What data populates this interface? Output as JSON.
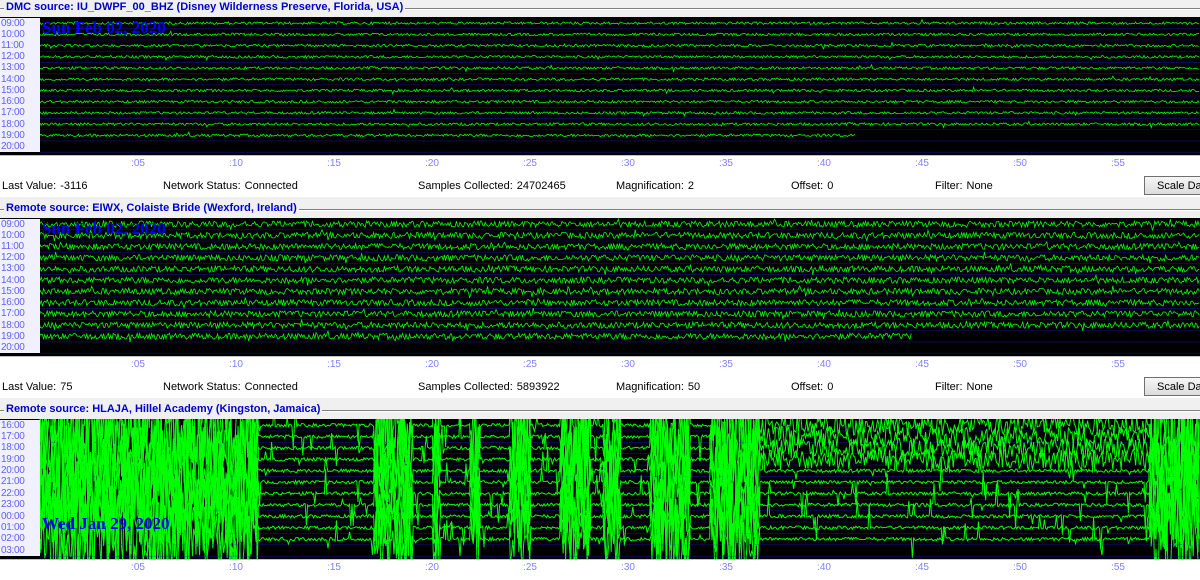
{
  "panels": [
    {
      "source": "DMC source: IU_DWPF_00_BHZ (Disney Wilderness Preserve, Florida, USA)",
      "date": "Sun Feb 02, 2020",
      "hours": [
        "09:00",
        "10:00",
        "11:00",
        "12:00",
        "13:00",
        "14:00",
        "15:00",
        "16:00",
        "17:00",
        "18:00",
        "19:00",
        "20:00"
      ],
      "status": {
        "last_value_label": "Last Value:",
        "last_value": "-3116",
        "network_label": "Network Status:",
        "network": "Connected",
        "samples_label": "Samples Collected:",
        "samples": "24702465",
        "mag_label": "Magnification:",
        "mag": "2",
        "offset_label": "Offset:",
        "offset": "0",
        "filter_label": "Filter:",
        "filter": "None",
        "scale_button": "Scale Data"
      }
    },
    {
      "source": "Remote source: EIWX, Colaiste Bride (Wexford, Ireland)",
      "date": "Sun Feb 02, 2020",
      "hours": [
        "09:00",
        "10:00",
        "11:00",
        "12:00",
        "13:00",
        "14:00",
        "15:00",
        "16:00",
        "17:00",
        "18:00",
        "19:00",
        "20:00"
      ],
      "status": {
        "last_value_label": "Last Value:",
        "last_value": "75",
        "network_label": "Network Status:",
        "network": "Connected",
        "samples_label": "Samples Collected:",
        "samples": "5893922",
        "mag_label": "Magnification:",
        "mag": "50",
        "offset_label": "Offset:",
        "offset": "0",
        "filter_label": "Filter:",
        "filter": "None",
        "scale_button": "Scale Data"
      }
    },
    {
      "source": "Remote source: HLAJA, Hillel Academy (Kingston, Jamaica)",
      "date": "Wed Jan 29, 2020",
      "hours": [
        "16:00",
        "17:00",
        "18:00",
        "19:00",
        "20:00",
        "21:00",
        "22:00",
        "23:00",
        "00:00",
        "01:00",
        "02:00",
        "03:00"
      ]
    }
  ],
  "minute_ticks": [
    ":05",
    ":10",
    ":15",
    ":20",
    ":25",
    ":30",
    ":35",
    ":40",
    ":45",
    ":50",
    ":55"
  ],
  "colors": {
    "trace": "#00ff00",
    "background": "#000000",
    "accent": "#0000cc",
    "hour_line": "#2020ff"
  }
}
